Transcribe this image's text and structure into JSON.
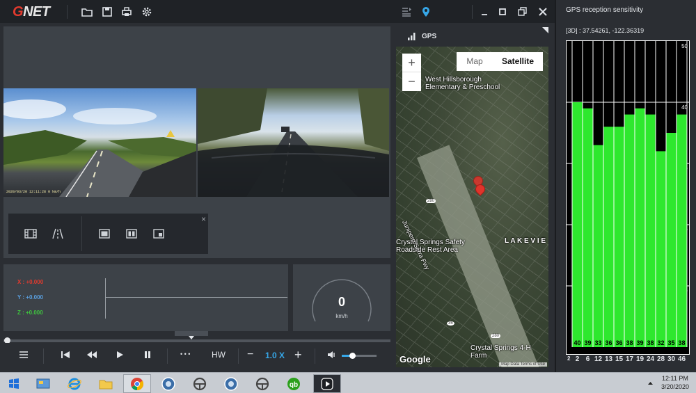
{
  "app": {
    "brand_g": "G",
    "brand_rest": "NET"
  },
  "toolbar": {
    "left_icons": [
      "folder-open-icon",
      "save-icon",
      "print-icon",
      "settings-icon"
    ],
    "right_icons": [
      "playlist-icon",
      "location-pin-icon"
    ],
    "window_controls": [
      "minimize-icon",
      "maximize-icon",
      "restore-icon",
      "close-icon"
    ]
  },
  "video": {
    "front_timestamp": "2020/03/20 12:11:28 0 km/h"
  },
  "layout_panel": {
    "icons": [
      "film-strip-icon",
      "road-lanes-icon",
      "single-view-icon",
      "split-view-icon",
      "pip-view-icon"
    ],
    "close": "×"
  },
  "gsensor": {
    "x": {
      "label": "X : +0.000",
      "color": "#e23a2e"
    },
    "y": {
      "label": "Y : +0.000",
      "color": "#5aa0e0"
    },
    "z": {
      "label": "Z : +0.000",
      "color": "#3ec43e"
    }
  },
  "speedometer": {
    "value": "0",
    "unit": "km/h"
  },
  "playback": {
    "progress": 0.0,
    "more": "• • •",
    "hw": "HW",
    "minus": "−",
    "speed": "1.0 X",
    "plus": "+",
    "volume": 0.3
  },
  "map": {
    "title": "GPS",
    "zoom_in": "+",
    "zoom_out": "−",
    "type_map": "Map",
    "type_satellite": "Satellite",
    "labels": {
      "school": "West Hillsborough\nElementary & Preschool",
      "rest_area": "Crystal Springs Safety\nRoadside Rest Area",
      "lakeview": "L A K E V I E",
      "farm": "Crystal Springs 4-H Farm",
      "junipero": "Junipero Serra Fwy",
      "shield_280a": "280",
      "shield_280b": "280",
      "shield_35": "35"
    },
    "google": "Google",
    "attribution": "Map Data   Terms of Use"
  },
  "gps_panel": {
    "title": "GPS reception sensitivity",
    "coords": "[3D] : 37.54261, -122.36319"
  },
  "chart_data": {
    "type": "bar",
    "title": "",
    "categories": [
      "2",
      "6",
      "12",
      "13",
      "15",
      "17",
      "19",
      "24",
      "28",
      "30",
      "46"
    ],
    "values": [
      40,
      39,
      33,
      36,
      36,
      38,
      39,
      38,
      32,
      35,
      38
    ],
    "value_labels": [
      "40",
      "39",
      "33",
      "36",
      "36",
      "38",
      "39",
      "38",
      "32",
      "35",
      "38"
    ],
    "extra_category_label": "2",
    "ylim": [
      0,
      50
    ],
    "y_ticks": [
      "50",
      "40",
      "30",
      "20",
      "10",
      "0"
    ],
    "bar_color": "#2ee82e",
    "background": "#000000",
    "grid": true
  },
  "taskbar": {
    "apps": [
      "windows-start-icon",
      "control-panel-icon",
      "internet-explorer-icon",
      "file-explorer-icon",
      "chrome-icon",
      "gnet-viewer-icon",
      "steering-wheel-icon",
      "gnet-viewer-2-icon",
      "steering-wheel-2-icon",
      "quickbooks-icon",
      "dashcam-player-icon"
    ],
    "time": "12:11 PM",
    "date": "3/20/2020"
  }
}
